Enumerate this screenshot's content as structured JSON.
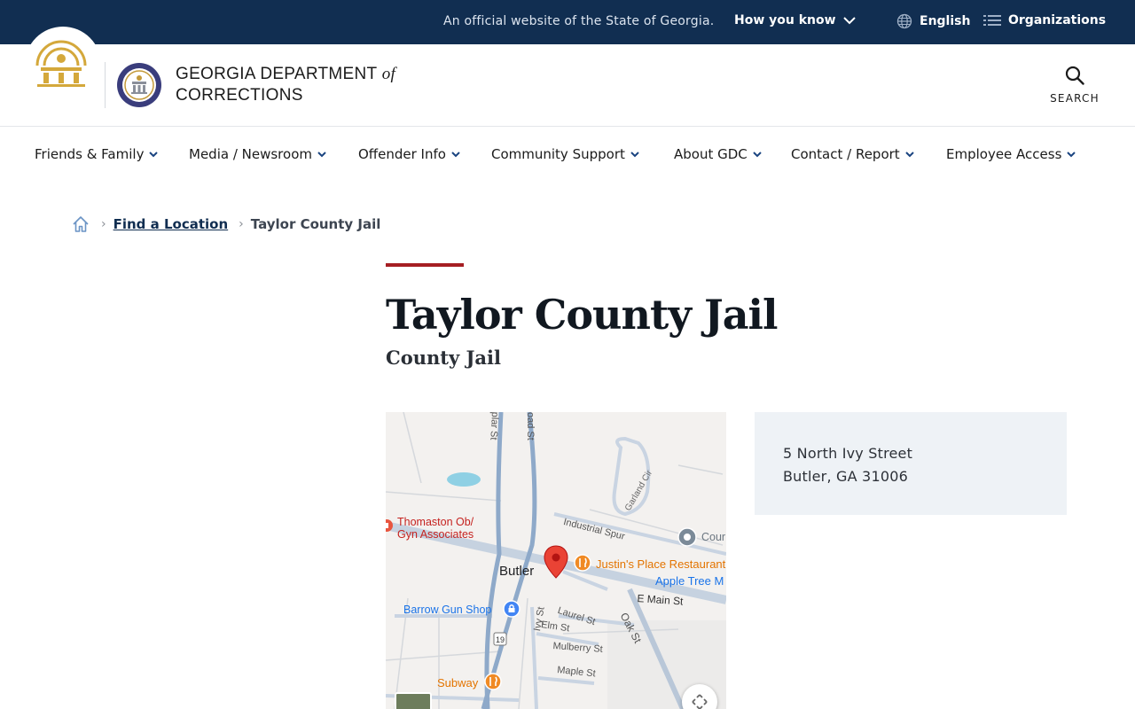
{
  "banner": {
    "official_text": "An official website of the State of Georgia.",
    "how_you_know": "How you know",
    "language": "English",
    "organizations": "Organizations"
  },
  "header": {
    "agency_line1": "GEORGIA DEPARTMENT",
    "agency_of": "of",
    "agency_line2": "CORRECTIONS",
    "search_label": "SEARCH"
  },
  "nav": {
    "items": [
      {
        "label": "Friends & Family"
      },
      {
        "label": "Media / Newsroom"
      },
      {
        "label": "Offender Info"
      },
      {
        "label": "Community Support"
      },
      {
        "label": "About GDC"
      },
      {
        "label": "Contact / Report"
      },
      {
        "label": "Employee Access"
      }
    ]
  },
  "breadcrumb": {
    "link": "Find a Location",
    "current": "Taylor County Jail"
  },
  "page": {
    "title": "Taylor County Jail",
    "subtitle": "County Jail"
  },
  "address": {
    "street": "5 North Ivy Street",
    "city_state_zip": "Butler, GA 31006"
  },
  "map": {
    "town": "Butler",
    "places": {
      "clinic": "Thomaston Ob/\nGyn Associates",
      "clinic_l1": "Thomaston Ob/",
      "clinic_l2": "Gyn Associates",
      "restaurant": "Justin's Place Restaurant",
      "apple": "Apple Tree M",
      "gun_shop": "Barrow Gun Shop",
      "subway": "Subway",
      "cou": "Cour"
    },
    "streets": {
      "poplar": "plar St",
      "railroad": "oad St",
      "garland": "Garland Cir",
      "industrial": "Industrial Spur",
      "main": "E Main St",
      "laurel": "Laurel St",
      "elm": "Elm St",
      "ivy": "Ivy St",
      "oak": "Oak St",
      "mulberry": "Mulberry St",
      "maple": "Maple St",
      "route": "19"
    }
  },
  "colors": {
    "banner_bg": "#112e51",
    "accent_red": "#a51e22",
    "card_bg": "#eef2f6"
  }
}
